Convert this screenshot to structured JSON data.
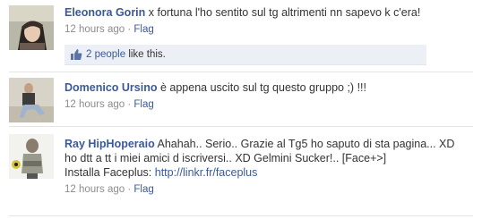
{
  "comments": [
    {
      "author": "Eleonora Gorin",
      "text": " x fortuna l'ho sentito sul tg altrimenti nn sapevo k c'era!",
      "time": "12 hours ago",
      "sep": " · ",
      "flag": "Flag",
      "likes": {
        "count": "2 people",
        "suffix": " like this."
      }
    },
    {
      "author": "Domenico Ursino",
      "text": " è appena uscito sul tg questo gruppo ;) !!!",
      "time": "12 hours ago",
      "sep": " · ",
      "flag": "Flag"
    },
    {
      "author": "Ray HipHoperaio",
      "text": " Ahahah.. Serio.. Grazie al Tg5 ho saputo di sta pagina... XD ho dtt a tt i miei amici d iscriversi.. XD Gelmini Sucker!.. [Face+>]",
      "app_prefix": "Installa Faceplus: ",
      "app_link": "http://linkr.fr/faceplus",
      "time": "12 hours ago",
      "sep": " · ",
      "flag": "Flag"
    }
  ],
  "colors": {
    "link": "#3b5998",
    "meta": "#8c8c8c",
    "likes_bg": "#eceff5"
  },
  "icons": {
    "like": "thumbs-up-icon"
  }
}
